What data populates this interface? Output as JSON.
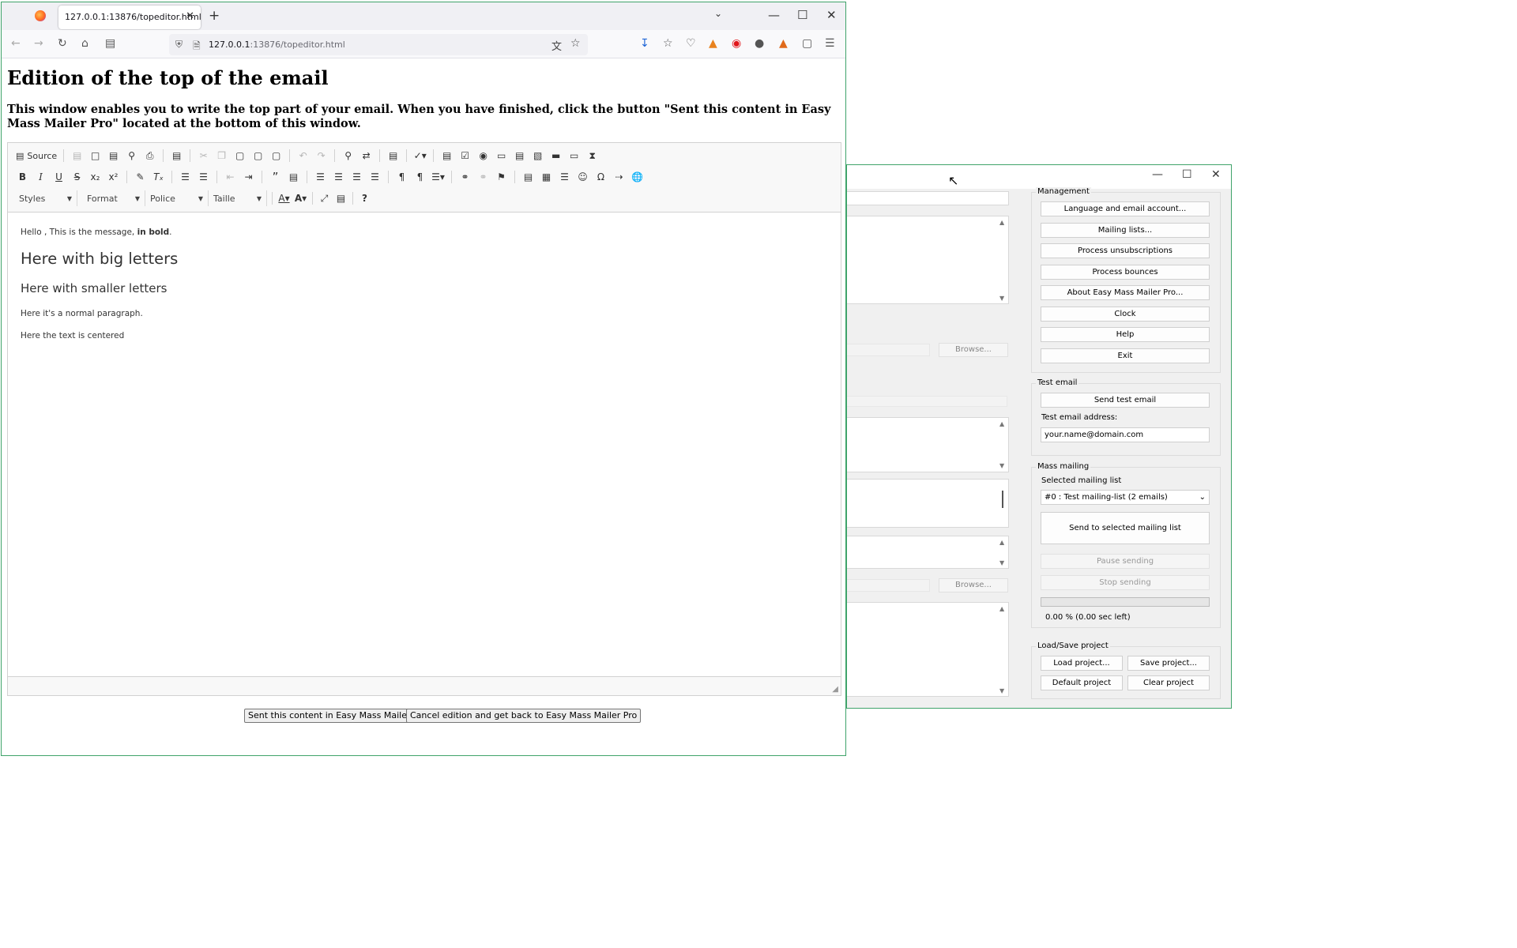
{
  "browser": {
    "tab_title": "127.0.0.1:13876/topeditor.html",
    "url_host": "127.0.0.1",
    "url_rest": ":13876/topeditor.html"
  },
  "page": {
    "heading": "Edition of the top of the email",
    "intro": "This window enables you to write the top part of your email. When you have finished, click the button \"Sent this content in Easy Mass Mailer Pro\" located at the bottom of this window.",
    "send_button": "Sent this content in Easy Mass Mailer Pro",
    "cancel_button": "Cancel edition and get back to Easy Mass Mailer Pro"
  },
  "editor": {
    "source_label": "Source",
    "combos": [
      "Styles",
      "Format",
      "Police",
      "Taille"
    ],
    "content": {
      "p1_plain": "Hello , This is the message, ",
      "p1_bold": "in bold",
      "p1_end": ".",
      "h2": "Here with big letters",
      "h3": "Here with smaller letters",
      "p2": "Here it's a normal paragraph.",
      "p3": "Here the text is centered"
    }
  },
  "app": {
    "management": {
      "title": "Management",
      "buttons": [
        "Language and email account...",
        "Mailing lists...",
        "Process unsubscriptions",
        "Process bounces",
        "About Easy Mass Mailer Pro...",
        "Clock",
        "Help",
        "Exit"
      ]
    },
    "test_email": {
      "title": "Test email",
      "send_button": "Send test email",
      "address_label": "Test email address:",
      "address_value": "your.name@domain.com"
    },
    "mass_mailing": {
      "title": "Mass mailing",
      "selected_label": "Selected mailing list",
      "selected_value": "#0 : Test mailing-list (2 emails)",
      "send_button": "Send to selected mailing list",
      "pause_button": "Pause sending",
      "stop_button": "Stop sending",
      "progress": 0,
      "progress_text": "0.00 % (0.00 sec left)"
    },
    "load_save": {
      "title": "Load/Save project",
      "load": "Load project...",
      "save": "Save project...",
      "default": "Default project",
      "clear": "Clear project"
    },
    "browse_label": "Browse..."
  }
}
